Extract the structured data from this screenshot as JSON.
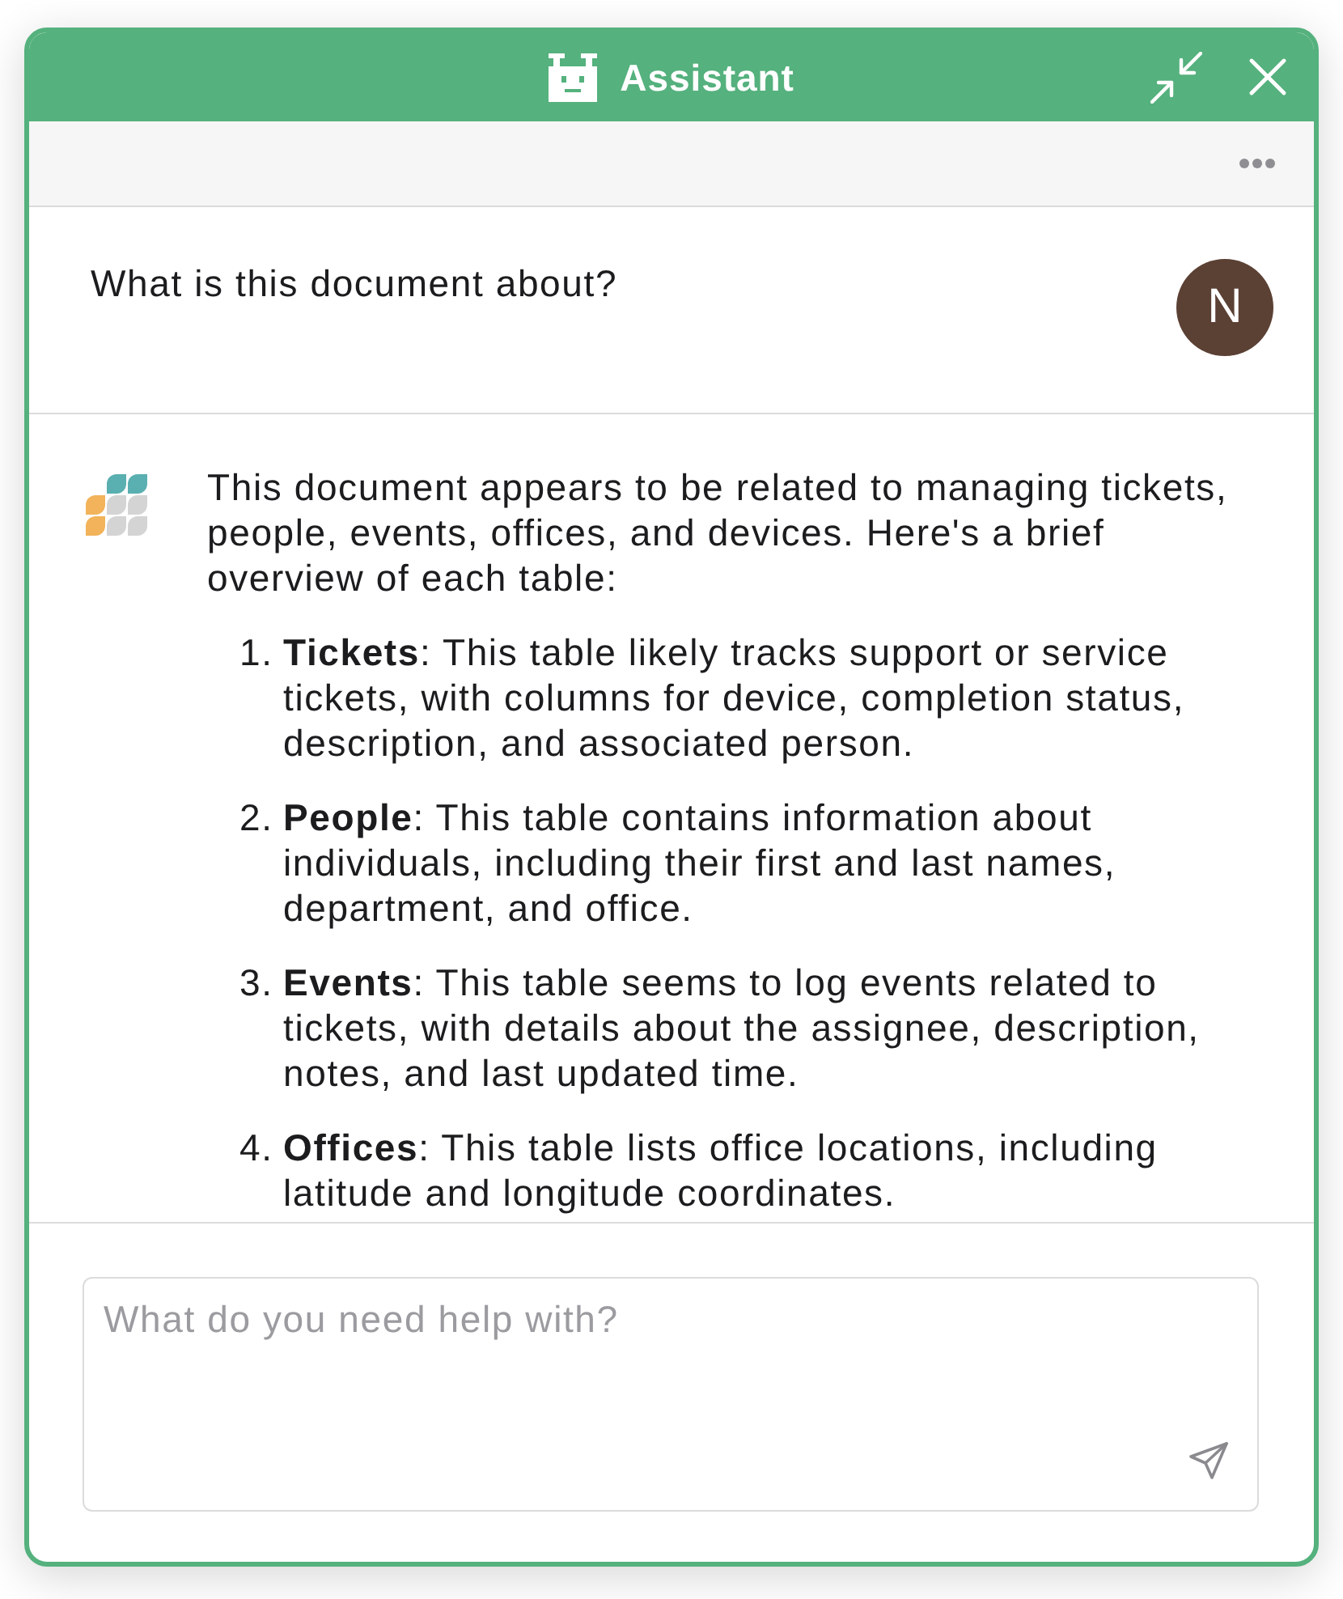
{
  "window": {
    "title": "Assistant"
  },
  "conversation": [
    {
      "kind": "user",
      "text": "What is this document about?",
      "avatar": "N"
    },
    {
      "kind": "assistant",
      "intro": "This document appears to be related to managing tickets, people, events, offices, and devices. Here's a brief overview of each table:",
      "items": [
        {
          "number": "1.",
          "text": "**Tickets**: This table likely tracks support or service tickets, with columns for device, completion status, description, and associated person."
        },
        {
          "number": "2.",
          "text": "**People**: This table contains information about individuals, including their first and last names, department, and office."
        },
        {
          "number": "3.",
          "text": "**Events**: This table seems to log events related to tickets, with details about the assignee, description, notes, and last updated time."
        },
        {
          "number": "4.",
          "text": "**Offices**: This table lists office locations, including latitude and longitude coordinates."
        }
      ]
    }
  ],
  "composer": {
    "placeholder": "What do you need help with?"
  }
}
